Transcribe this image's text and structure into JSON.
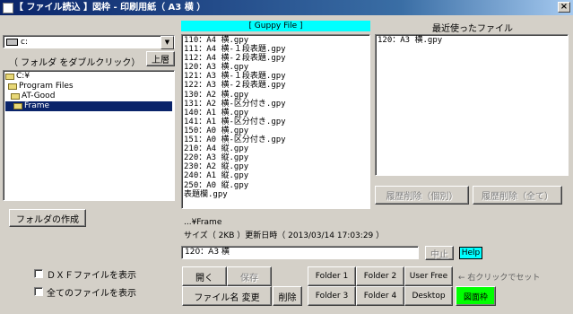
{
  "window": {
    "title": "【 ファイル読込 】図枠 - 印刷用紙（ A3 横 ）",
    "close_label": "×"
  },
  "left": {
    "drive_value": "c:",
    "hint": "（ フォルダ をダブルクリック）",
    "up_label": "上層",
    "tree": [
      "C:¥",
      "Program Files",
      "AT-Good",
      "Frame"
    ],
    "create_folder_label": "フォルダの作成",
    "show_dxf_label": "ＤＸＦファイルを表示",
    "show_all_label": "全てのファイルを表示"
  },
  "file_list": {
    "header": "[ Guppy File ]",
    "items": [
      "110：A4 横.gpy",
      "111：A4 横-１段表題.gpy",
      "112：A4 横-２段表題.gpy",
      "120：A3 横.gpy",
      "121：A3 横-１段表題.gpy",
      "122：A3 横-２段表題.gpy",
      "130：A2 横.gpy",
      "131：A2 横-区分付き.gpy",
      "140：A1 横.gpy",
      "141：A1 横-区分付き.gpy",
      "150：A0 横.gpy",
      "151：A0 横-区分付き.gpy",
      "210：A4 縦.gpy",
      "220：A3 縦.gpy",
      "230：A2 縦.gpy",
      "240：A1 縦.gpy",
      "250：A0 縦.gpy",
      "表題欄.gpy"
    ]
  },
  "recent": {
    "header": "最近使ったファイル",
    "items": [
      "120：A3 横.gpy"
    ],
    "delete_one_label": "履歴削除（個別）",
    "delete_all_label": "履歴削除（全て）"
  },
  "info": {
    "path": "...¥Frame",
    "detail": "サイズ（ 2KB ）更新日時（ 2013/03/14 17:03:29 ）",
    "filename_value": "120：A3 横",
    "stop_label": "中止",
    "help_label": "Help"
  },
  "buttons": {
    "open": "開く",
    "save": "保存",
    "rename": "ファイル名 変更",
    "delete": "削除",
    "folder1": "Folder 1",
    "folder2": "Folder 2",
    "folder3": "Folder 3",
    "folder4": "Folder 4",
    "user_free": "User Free",
    "desktop": "Desktop",
    "zuwaku": "図面枠",
    "right_click_hint": "← 右クリックでセット"
  },
  "colors": {
    "guppy_header_bg": "#00ffff",
    "help_bg": "#00ffff",
    "zuwaku_bg": "#00ff00",
    "selection": "#0a246a"
  }
}
